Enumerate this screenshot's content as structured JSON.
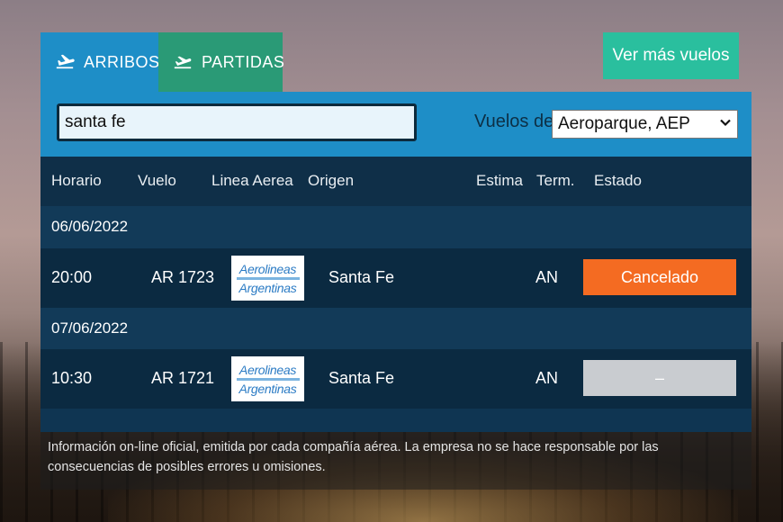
{
  "tabs": {
    "arribos": "ARRIBOS",
    "partidas": "PARTIDAS"
  },
  "ver_mas": "Ver más vuelos",
  "search": {
    "value": "santa fe"
  },
  "vuelos_de": {
    "label": "Vuelos de",
    "selected": "Aeroparque, AEP"
  },
  "table": {
    "headers": {
      "horario": "Horario",
      "vuelo": "Vuelo",
      "linea": "Linea Aerea",
      "origen": "Origen",
      "estima": "Estima",
      "term": "Term.",
      "estado": "Estado"
    },
    "groups": [
      {
        "date": "06/06/2022",
        "flight": {
          "horario": "20:00",
          "vuelo": "AR 1723",
          "logo_line1": "Aerolineas",
          "logo_line2": "Argentinas",
          "origen": "Santa Fe",
          "term": "AN",
          "estado": "Cancelado"
        }
      },
      {
        "date": "07/06/2022",
        "flight": {
          "horario": "10:30",
          "vuelo": "AR 1721",
          "logo_line1": "Aerolineas",
          "logo_line2": "Argentinas",
          "origen": "Santa Fe",
          "term": "AN",
          "estado": "–"
        }
      }
    ]
  },
  "disclaimer": "Información on-line oficial, emitida por cada compañía aérea. La empresa no se hace responsable por las consecuencias de posibles errores u omisiones.",
  "colors": {
    "tab_arribos": "#1e8ec7",
    "tab_partidas": "#2a9a76",
    "ver_mas": "#2abf9e",
    "cancelado": "#f46b22",
    "status_neutral": "#c9ccd0",
    "table_bg": "#0c2d45"
  },
  "icons": {
    "arribos": "plane-landing-icon",
    "partidas": "plane-takeoff-icon",
    "select": "chevron-down-icon"
  }
}
